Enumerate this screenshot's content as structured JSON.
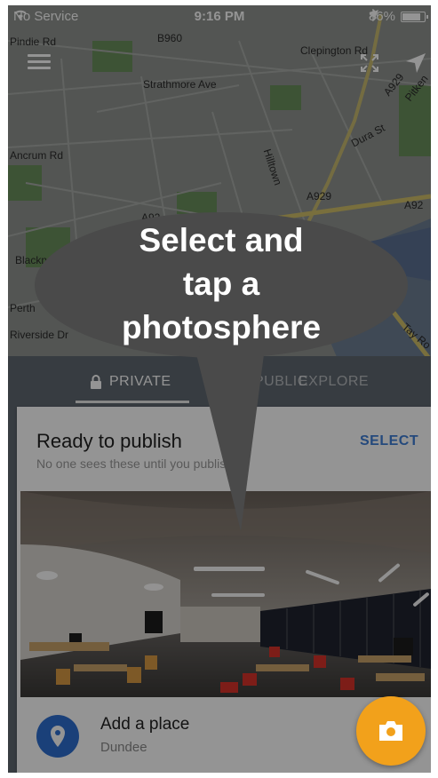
{
  "status_bar": {
    "carrier": "No Service",
    "time": "9:16 PM",
    "battery": "86%",
    "battery_level": 0.86
  },
  "map": {
    "labels": [
      "Pindie Rd",
      "B960",
      "Clepington Rd",
      "Strathmore Ave",
      "Dura St",
      "A929",
      "Pitken",
      "Ancrum Rd",
      "Hilltown",
      "A929",
      "A92",
      "A92",
      "Blackn",
      "Perth",
      "Riverside Dr",
      "Tay Ro"
    ]
  },
  "tabs": [
    {
      "label": "PRIVATE",
      "active": true
    },
    {
      "label": "PUBLIC",
      "active": false
    },
    {
      "label": "EXPLORE",
      "active": false
    }
  ],
  "card": {
    "title": "Ready to publish",
    "subtitle": "No one sees these until you publish",
    "select_label": "SELECT"
  },
  "place": {
    "title": "Add a place",
    "subtitle": "Dundee"
  },
  "overlay": {
    "lines": [
      "Select and",
      "tap a",
      "photosphere"
    ]
  },
  "icons": {
    "menu": "menu-icon",
    "expand": "expand-icon",
    "locate": "navigation-arrow-icon",
    "lock": "lock-icon",
    "pin": "location-pin-icon",
    "camera": "camera-icon"
  },
  "colors": {
    "accent": "#3f7fd6",
    "fab": "#f2a11b",
    "pin_circle": "#2e6fd0",
    "bubble": "#4a4a4a"
  }
}
